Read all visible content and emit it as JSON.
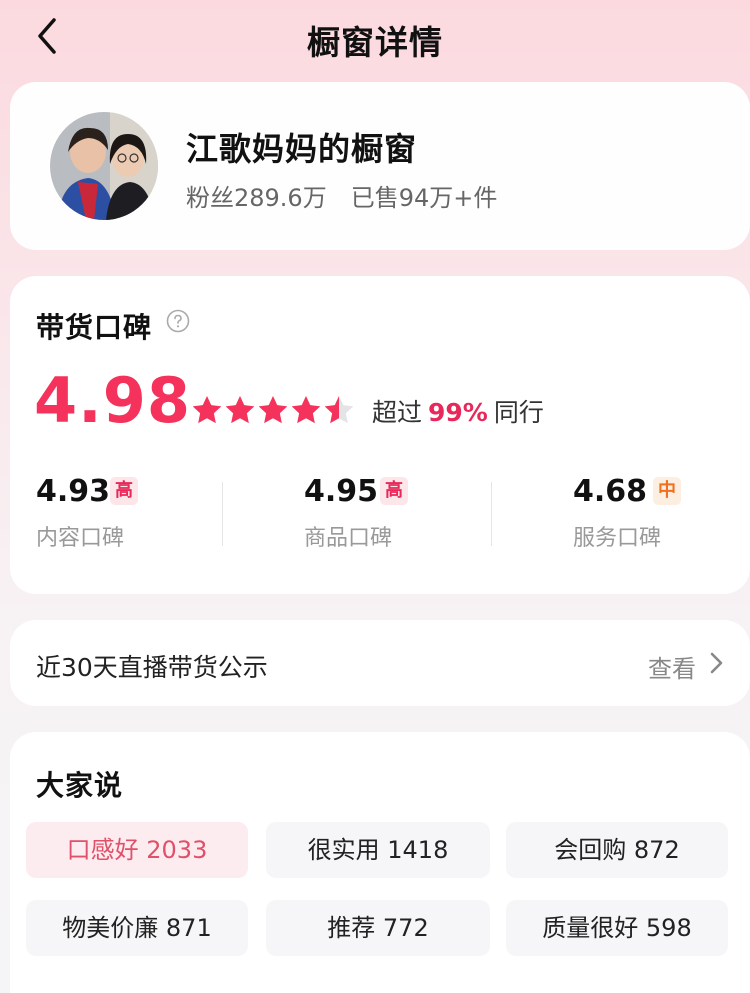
{
  "header": {
    "title": "橱窗详情"
  },
  "profile": {
    "name": "江歌妈妈的橱窗",
    "fans": "粉丝289.6万",
    "sold": "已售94万+件"
  },
  "rating": {
    "title": "带货口碑",
    "score": "4.98",
    "stars": 4.5,
    "compare_prefix": "超过",
    "compare_pct": "99%",
    "compare_suffix": "同行",
    "subs": [
      {
        "score": "4.93",
        "badge": "高",
        "label": "内容口碑"
      },
      {
        "score": "4.95",
        "badge": "高",
        "label": "商品口碑"
      },
      {
        "score": "4.68",
        "badge": "中",
        "label": "服务口碑"
      }
    ]
  },
  "live": {
    "label": "近30天直播带货公示",
    "action": "查看"
  },
  "tags": {
    "title": "大家说",
    "items": [
      "口感好 2033",
      "很实用 1418",
      "会回购 872",
      "物美价廉 871",
      "推荐 772",
      "质量很好 598"
    ]
  },
  "colors": {
    "accent": "#f5325c",
    "badge_high": "#e8285a",
    "badge_mid": "#f07020"
  }
}
